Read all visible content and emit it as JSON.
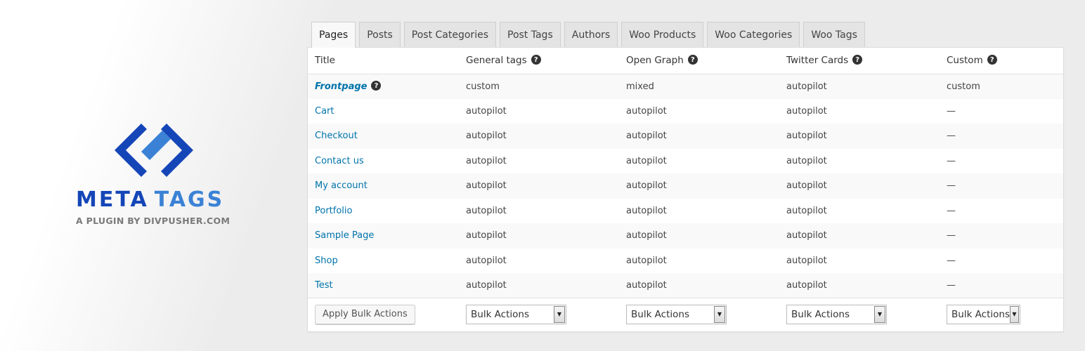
{
  "brand": {
    "title_word1": "META",
    "title_word2": "TAGS",
    "subtitle": "A PLUGIN BY DIVPUSHER.COM",
    "colors": {
      "dark_blue": "#1546b8",
      "light_blue": "#3b82d6",
      "gray": "#7a7a7a"
    }
  },
  "tabs": [
    {
      "label": "Pages",
      "active": true
    },
    {
      "label": "Posts"
    },
    {
      "label": "Post Categories"
    },
    {
      "label": "Post Tags"
    },
    {
      "label": "Authors"
    },
    {
      "label": "Woo Products"
    },
    {
      "label": "Woo Categories"
    },
    {
      "label": "Woo Tags"
    }
  ],
  "table": {
    "headers": {
      "title": "Title",
      "general": "General tags",
      "opengraph": "Open Graph",
      "twitter": "Twitter Cards",
      "custom": "Custom",
      "help_glyph": "?"
    },
    "rows": [
      {
        "title": "Frontpage",
        "general": "custom",
        "opengraph": "mixed",
        "twitter": "autopilot",
        "custom": "custom"
      },
      {
        "title": "Cart",
        "general": "autopilot",
        "opengraph": "autopilot",
        "twitter": "autopilot",
        "custom": "—"
      },
      {
        "title": "Checkout",
        "general": "autopilot",
        "opengraph": "autopilot",
        "twitter": "autopilot",
        "custom": "—"
      },
      {
        "title": "Contact us",
        "general": "autopilot",
        "opengraph": "autopilot",
        "twitter": "autopilot",
        "custom": "—"
      },
      {
        "title": "My account",
        "general": "autopilot",
        "opengraph": "autopilot",
        "twitter": "autopilot",
        "custom": "—"
      },
      {
        "title": "Portfolio",
        "general": "autopilot",
        "opengraph": "autopilot",
        "twitter": "autopilot",
        "custom": "—"
      },
      {
        "title": "Sample Page",
        "general": "autopilot",
        "opengraph": "autopilot",
        "twitter": "autopilot",
        "custom": "—"
      },
      {
        "title": "Shop",
        "general": "autopilot",
        "opengraph": "autopilot",
        "twitter": "autopilot",
        "custom": "—"
      },
      {
        "title": "Test",
        "general": "autopilot",
        "opengraph": "autopilot",
        "twitter": "autopilot",
        "custom": "—"
      }
    ],
    "footer": {
      "apply_button": "Apply Bulk Actions",
      "bulk_general": "Bulk Actions",
      "bulk_opengraph": "Bulk Actions",
      "bulk_twitter": "Bulk Actions",
      "bulk_custom": "Bulk Actions"
    },
    "link_color": "#0073aa"
  }
}
